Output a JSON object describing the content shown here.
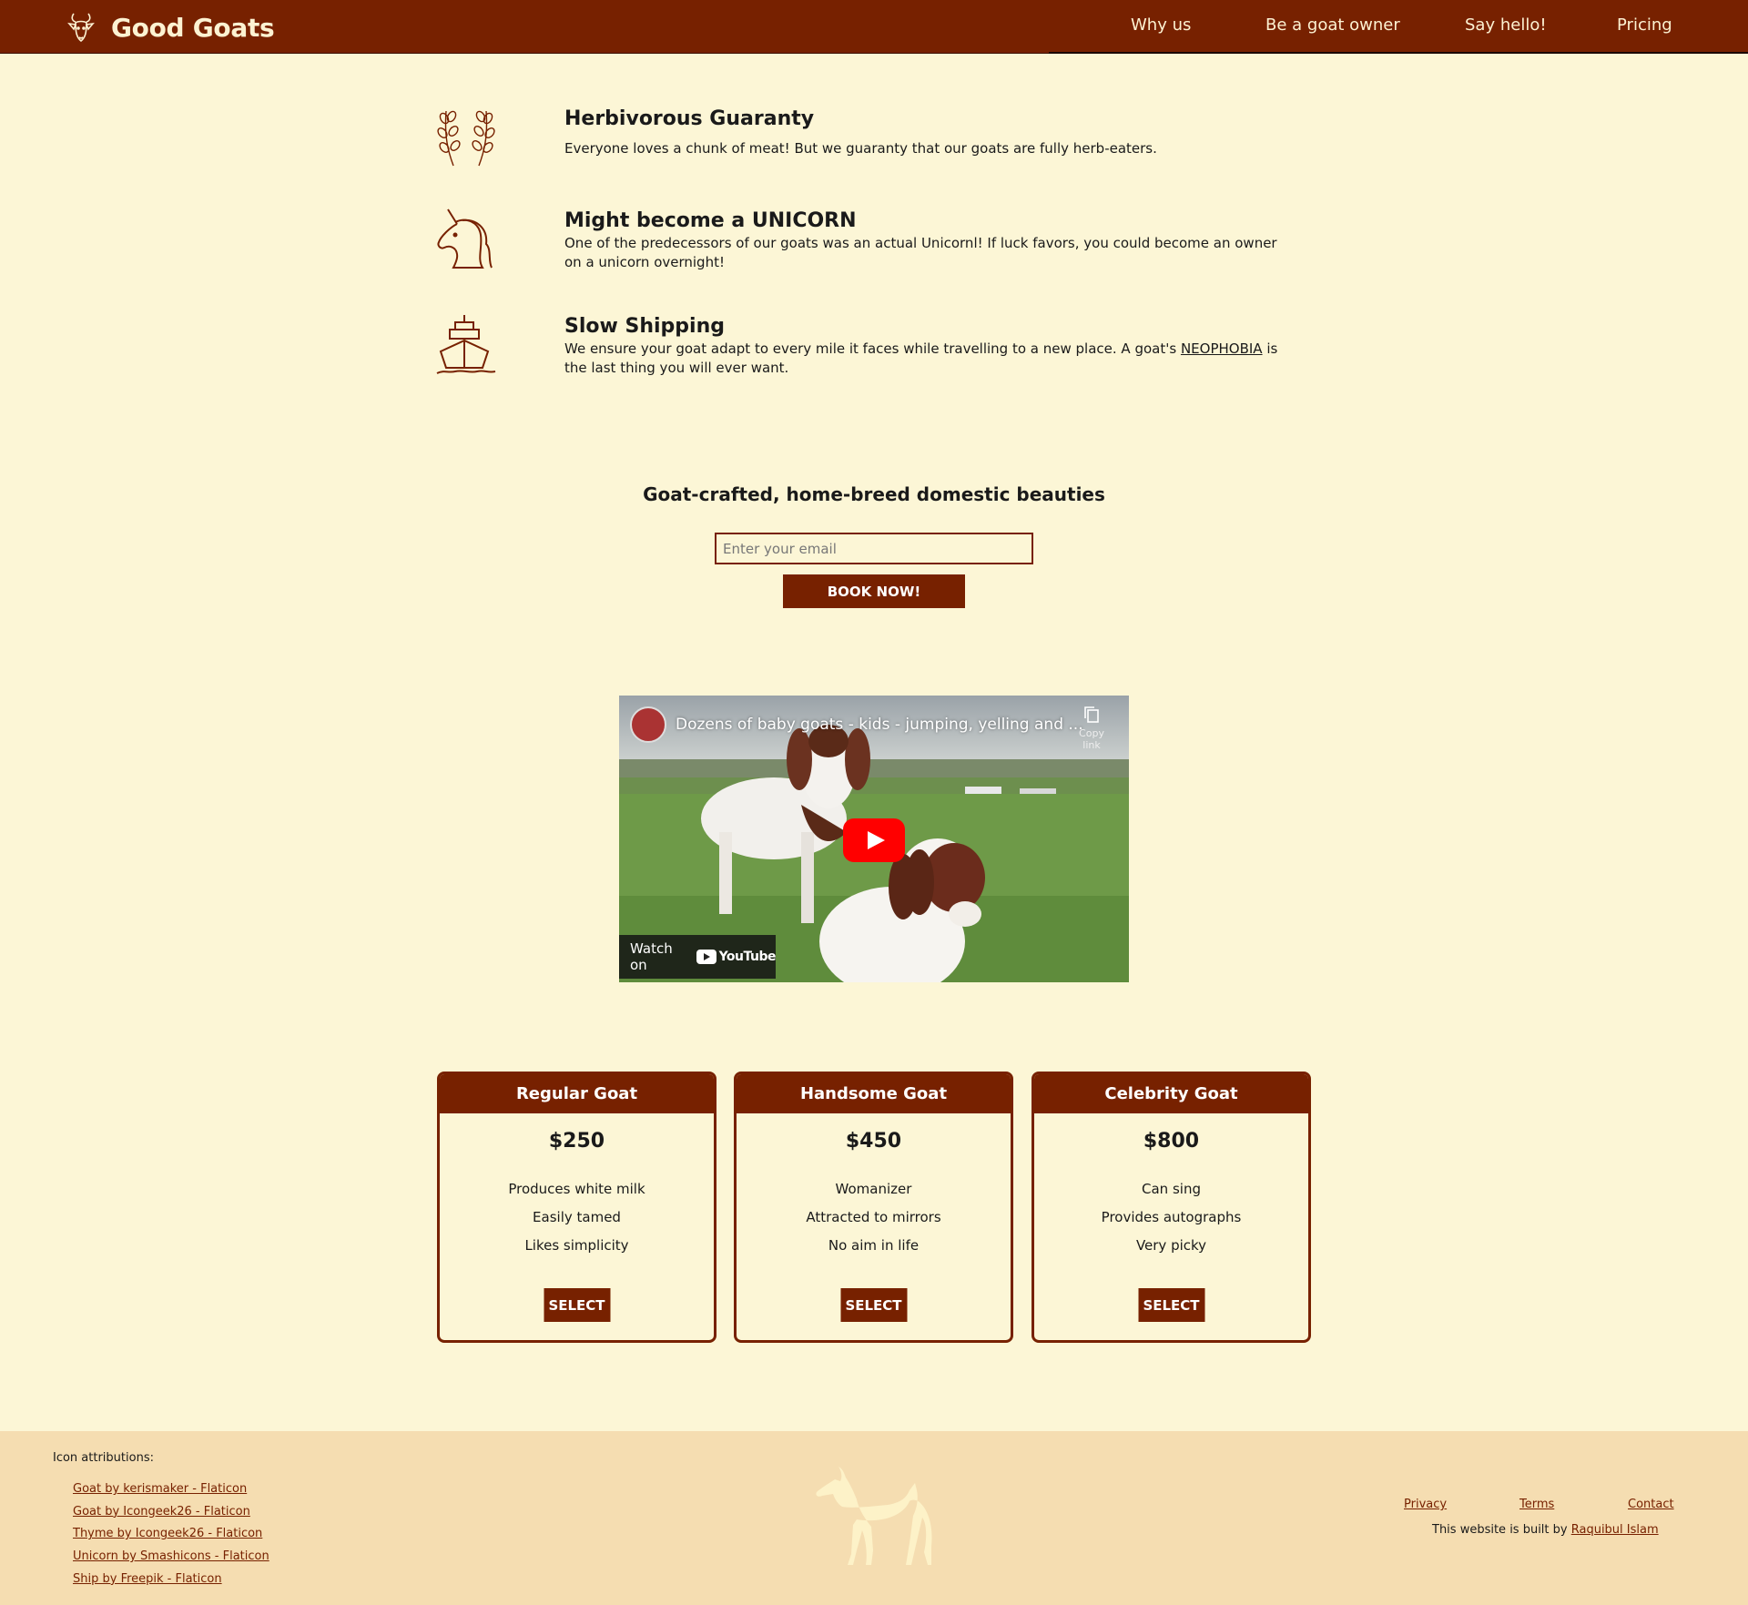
{
  "nav": {
    "brand": "Good Goats",
    "links": [
      "Why us",
      "Be a goat owner",
      "Say hello!",
      "Pricing"
    ]
  },
  "features": [
    {
      "icon": "herb-icon",
      "title": "Herbivorous Guaranty",
      "text": "Everyone loves a chunk of meat! But we guaranty that our goats are fully herb-eaters."
    },
    {
      "icon": "unicorn-icon",
      "title": "Might become a UNICORN",
      "text": "One of the predecessors of our goats was an actual Unicornl! If luck favors, you could become an owner on a unicorn overnight!"
    },
    {
      "icon": "ship-icon",
      "title": "Slow Shipping",
      "text_before": "We ensure your goat adapt to every mile it faces while travelling to a new place. A goat's ",
      "link": "NEOPHOBIA",
      "text_after": " is the last thing you will ever want."
    }
  ],
  "book": {
    "heading": "Goat-crafted, home-breed domestic beauties",
    "email_placeholder": "Enter your email",
    "button": "BOOK NOW!"
  },
  "video": {
    "title": "Dozens of baby goats - kids - jumping, yelling and ...",
    "copy_link": "Copy link",
    "watch_on": "Watch on",
    "youtube": "YouTube"
  },
  "pricing": [
    {
      "name": "Regular Goat",
      "price": "$250",
      "features": [
        "Produces white milk",
        "Easily tamed",
        "Likes simplicity"
      ],
      "button": "SELECT"
    },
    {
      "name": "Handsome Goat",
      "price": "$450",
      "features": [
        "Womanizer",
        "Attracted to mirrors",
        "No aim in life"
      ],
      "button": "SELECT"
    },
    {
      "name": "Celebrity Goat",
      "price": "$800",
      "features": [
        "Can sing",
        "Provides autographs",
        "Very picky"
      ],
      "button": "SELECT"
    }
  ],
  "footer": {
    "attr_title": "Icon attributions:",
    "attributions": [
      "Goat by kerismaker - Flaticon",
      "Goat by Icongeek26 - Flaticon",
      "Thyme by Icongeek26 - Flaticon",
      "Unicorn by Smashicons - Flaticon",
      "Ship by Freepik - Flaticon"
    ],
    "links": [
      "Privacy",
      "Terms",
      "Contact"
    ],
    "built_by": "This website is built by ",
    "author": "Raquibul Islam"
  },
  "colors": {
    "brand": "#772100",
    "background": "#fcf6d6",
    "footer": "#f5ddb1"
  }
}
